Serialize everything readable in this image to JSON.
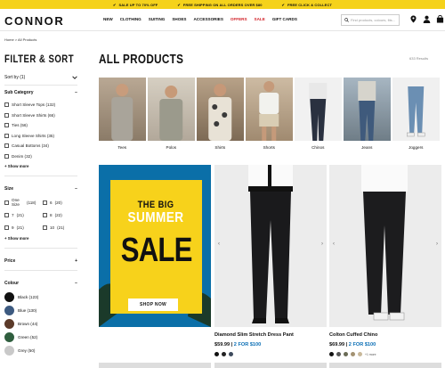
{
  "promo": [
    "SALE UP TO 70% OFF",
    "FREE SHIPPING ON ALL ORDERS OVER $80",
    "FREE CLICK & COLLECT"
  ],
  "brand": "CONNOR",
  "nav": [
    {
      "label": "NEW",
      "red": false
    },
    {
      "label": "CLOTHING",
      "red": false
    },
    {
      "label": "SUITING",
      "red": false
    },
    {
      "label": "SHOES",
      "red": false
    },
    {
      "label": "ACCESSORIES",
      "red": false
    },
    {
      "label": "OFFERS",
      "red": true
    },
    {
      "label": "SALE",
      "red": true
    },
    {
      "label": "GIFT CARDS",
      "red": false
    }
  ],
  "search": {
    "placeholder": "Find products, colours, fits..."
  },
  "breadcrumb": "Home > All Products",
  "filter_title": "FILTER & SORT",
  "sort_by": "Sort by (1)",
  "subcategory": {
    "title": "Sub Category",
    "items": [
      "Short Sleeve Tops (132)",
      "Short Sleeve Shirts (66)",
      "Ties (56)",
      "Long Sleeve Shirts (35)",
      "Casual Bottoms (34)",
      "Denim (32)"
    ],
    "more": "+ Show more"
  },
  "size": {
    "title": "Size",
    "items": [
      {
        "label": "One Size",
        "count": "(118)"
      },
      {
        "label": "6",
        "count": "(20)"
      },
      {
        "label": "7",
        "count": "(21)"
      },
      {
        "label": "8",
        "count": "(22)"
      },
      {
        "label": "9",
        "count": "(21)"
      },
      {
        "label": "10",
        "count": "(21)"
      }
    ],
    "more": "+ Show more"
  },
  "price": {
    "title": "Price"
  },
  "colour": {
    "title": "Colour",
    "items": [
      {
        "label": "Black (123)",
        "color": "#111111"
      },
      {
        "label": "Blue (130)",
        "color": "#3d5a80"
      },
      {
        "label": "Brown (44)",
        "color": "#5b3a29"
      },
      {
        "label": "Green (52)",
        "color": "#2f5e3e"
      },
      {
        "label": "Grey (50)",
        "color": "#c9c9c9"
      }
    ]
  },
  "page_title": "ALL PRODUCTS",
  "results": "633 Results",
  "categories": [
    "Tees",
    "Polos",
    "Shirts",
    "Shorts",
    "Chinos",
    "Jeans",
    "Joggers"
  ],
  "sale_banner": {
    "line1": "THE BIG",
    "line2": "SUMMER",
    "line3": "SALE",
    "button": "SHOP NOW"
  },
  "products": [
    {
      "name": "Diamond Slim Stretch Dress Pant",
      "price": "$59.99",
      "deal": "2 FOR $100",
      "swatches": [
        "#111",
        "#222",
        "#3d4a5c"
      ],
      "more": ""
    },
    {
      "name": "Colton Cuffed Chino",
      "price": "$69.99",
      "deal": "2 FOR $100",
      "swatches": [
        "#111",
        "#555",
        "#6a6b55",
        "#a39272",
        "#c8b89a"
      ],
      "more": "+1 more"
    }
  ],
  "colors": {
    "promo": "#f5d21b",
    "accent_red": "#d2232a",
    "deal_blue": "#0a6eb5"
  }
}
